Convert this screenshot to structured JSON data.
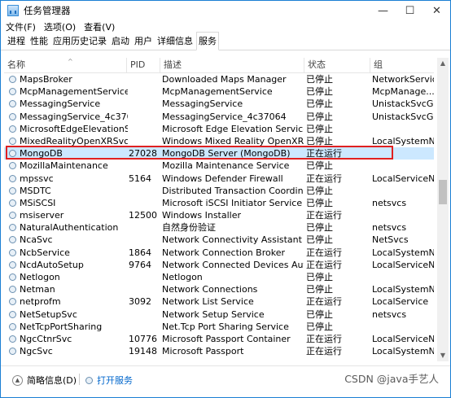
{
  "window": {
    "title": "任务管理器",
    "minimize": "—",
    "maximize": "☐",
    "close": "✕"
  },
  "menu": [
    "文件(F)",
    "选项(O)",
    "查看(V)"
  ],
  "tabs": [
    "进程",
    "性能",
    "应用历史记录",
    "启动",
    "用户",
    "详细信息",
    "服务"
  ],
  "active_tab": "服务",
  "columns": {
    "name": "名称",
    "pid": "PID",
    "desc": "描述",
    "status": "状态",
    "group": "组"
  },
  "rows": [
    {
      "name": "MapsBroker",
      "pid": "",
      "desc": "Downloaded Maps Manager",
      "status": "已停止",
      "group": "NetworkService"
    },
    {
      "name": "McpManagementService",
      "pid": "",
      "desc": "McpManagementService",
      "status": "已停止",
      "group": "McpManage..."
    },
    {
      "name": "MessagingService",
      "pid": "",
      "desc": "MessagingService",
      "status": "已停止",
      "group": "UnistackSvcGr..."
    },
    {
      "name": "MessagingService_4c370...",
      "pid": "",
      "desc": "MessagingService_4c37064",
      "status": "已停止",
      "group": "UnistackSvcGr..."
    },
    {
      "name": "MicrosoftEdgeElevationSe...",
      "pid": "",
      "desc": "Microsoft Edge Elevation Service (...",
      "status": "已停止",
      "group": ""
    },
    {
      "name": "MixedRealityOpenXRSvc",
      "pid": "",
      "desc": "Windows Mixed Reality OpenXR S...",
      "status": "已停止",
      "group": "LocalSystemN..."
    },
    {
      "name": "MongoDB",
      "pid": "27028",
      "desc": "MongoDB Server (MongoDB)",
      "status": "正在运行",
      "group": ""
    },
    {
      "name": "MozillaMaintenance",
      "pid": "",
      "desc": "Mozilla Maintenance Service",
      "status": "已停止",
      "group": ""
    },
    {
      "name": "mpssvc",
      "pid": "5164",
      "desc": "Windows Defender Firewall",
      "status": "正在运行",
      "group": "LocalServiceN..."
    },
    {
      "name": "MSDTC",
      "pid": "",
      "desc": "Distributed Transaction Coordinator",
      "status": "已停止",
      "group": ""
    },
    {
      "name": "MSiSCSI",
      "pid": "",
      "desc": "Microsoft iSCSI Initiator Service",
      "status": "已停止",
      "group": "netsvcs"
    },
    {
      "name": "msiserver",
      "pid": "12500",
      "desc": "Windows Installer",
      "status": "正在运行",
      "group": ""
    },
    {
      "name": "NaturalAuthentication",
      "pid": "",
      "desc": "自然身份验证",
      "status": "已停止",
      "group": "netsvcs"
    },
    {
      "name": "NcaSvc",
      "pid": "",
      "desc": "Network Connectivity Assistant",
      "status": "已停止",
      "group": "NetSvcs"
    },
    {
      "name": "NcbService",
      "pid": "1864",
      "desc": "Network Connection Broker",
      "status": "正在运行",
      "group": "LocalSystemN..."
    },
    {
      "name": "NcdAutoSetup",
      "pid": "9764",
      "desc": "Network Connected Devices Auto-...",
      "status": "正在运行",
      "group": "LocalServiceN..."
    },
    {
      "name": "Netlogon",
      "pid": "",
      "desc": "Netlogon",
      "status": "已停止",
      "group": ""
    },
    {
      "name": "Netman",
      "pid": "",
      "desc": "Network Connections",
      "status": "已停止",
      "group": "LocalSystemN..."
    },
    {
      "name": "netprofm",
      "pid": "3092",
      "desc": "Network List Service",
      "status": "正在运行",
      "group": "LocalService"
    },
    {
      "name": "NetSetupSvc",
      "pid": "",
      "desc": "Network Setup Service",
      "status": "已停止",
      "group": "netsvcs"
    },
    {
      "name": "NetTcpPortSharing",
      "pid": "",
      "desc": "Net.Tcp Port Sharing Service",
      "status": "已停止",
      "group": ""
    },
    {
      "name": "NgcCtnrSvc",
      "pid": "10776",
      "desc": "Microsoft Passport Container",
      "status": "正在运行",
      "group": "LocalServiceN..."
    },
    {
      "name": "NgcSvc",
      "pid": "19148",
      "desc": "Microsoft Passport",
      "status": "正在运行",
      "group": "LocalSystemN..."
    }
  ],
  "selected_index": 6,
  "footer": {
    "brief": "简略信息(D)",
    "open_services": "打开服务"
  },
  "watermark": "CSDN @java手艺人"
}
